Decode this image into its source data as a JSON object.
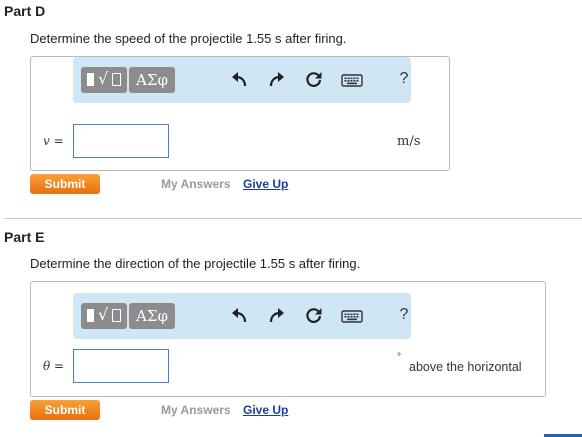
{
  "parts": [
    {
      "title": "Part D",
      "question": "Determine the speed of the projectile 1.55 s after firing.",
      "toolbar": {
        "templates_icon": "templates-icon",
        "greek_label": "ΑΣφ",
        "help_label": "?"
      },
      "variable_label": "v =",
      "input_value": "",
      "unit": "m/s",
      "submit_label": "Submit",
      "my_answers_label": "My Answers",
      "give_up_label": "Give Up"
    },
    {
      "title": "Part E",
      "question": "Determine the direction of the projectile 1.55 s after firing.",
      "toolbar": {
        "templates_icon": "templates-icon",
        "greek_label": "ΑΣφ",
        "help_label": "?"
      },
      "variable_label": "θ =",
      "input_value": "",
      "unit_symbol": "°",
      "unit": "above the horizontal",
      "submit_label": "Submit",
      "my_answers_label": "My Answers",
      "give_up_label": "Give Up"
    }
  ],
  "colors": {
    "toolbar_bg": "#cfe6f5",
    "submit_bg": "#f08a24",
    "link": "#1a3f9b",
    "input_border": "#4a7bd0"
  }
}
